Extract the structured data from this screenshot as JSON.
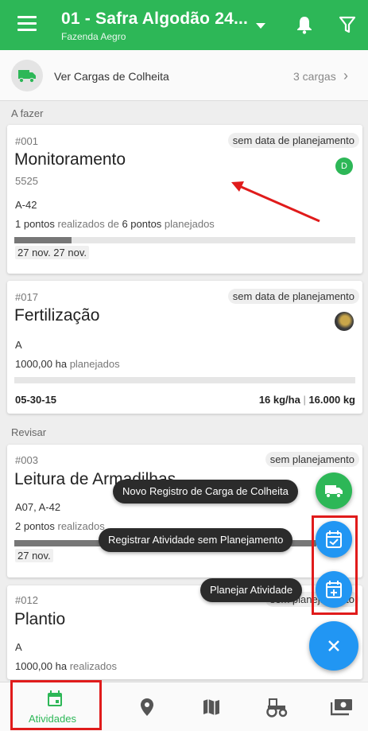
{
  "header": {
    "title": "01 - Safra Algodão 24...",
    "subtitle": "Fazenda Aegro",
    "menu_icon": "hamburger-menu-icon",
    "dropdown_icon": "caret-down-icon",
    "bell_icon": "bell-icon",
    "filter_icon": "filter-icon"
  },
  "cargas": {
    "label": "Ver Cargas de Colheita",
    "count": "3 cargas",
    "icon": "truck-icon"
  },
  "sections": {
    "todo": "A fazer",
    "review": "Revisar"
  },
  "cards": [
    {
      "number": "#001",
      "tag": "sem data de planejamento",
      "name": "Monitoramento",
      "sub": "5525",
      "area": "A-42",
      "progress_a": "1 pontos",
      "progress_b": " realizados de ",
      "progress_c": "6 pontos",
      "progress_d": " planejados",
      "progress_fraction": 0.167,
      "dates": "27 nov.  27 nov.",
      "avatar": "D"
    },
    {
      "number": "#017",
      "tag": "sem data de planejamento",
      "name": "Fertilização",
      "area": "A",
      "amount": "1000,00 ha",
      "amount_label": " planejados",
      "progress_fraction": 0,
      "date": "05-30-15",
      "dose": "16 kg/ha",
      "separator": " | ",
      "total": "16.000 kg"
    },
    {
      "number": "#003",
      "tag": "sem planejamento",
      "name": "Leitura de Armadilhas",
      "area": "A07, A-42",
      "amount": "2 pontos",
      "amount_label": " realizados",
      "dates": "27 nov."
    },
    {
      "number": "#012",
      "tag": "sem planejamento",
      "name": "Plantio",
      "area": "A",
      "amount": "1000,00 ha",
      "amount_label": " realizados"
    }
  ],
  "speed_dial": {
    "items": [
      {
        "label": "Novo Registro de Carga de Colheita",
        "icon": "truck-icon",
        "color": "#2db757"
      },
      {
        "label": "Registrar Atividade sem Planejamento",
        "icon": "calendar-check-icon",
        "color": "#2196f3"
      },
      {
        "label": "Planejar Atividade",
        "icon": "calendar-add-icon",
        "color": "#2196f3"
      }
    ],
    "close_icon": "close-icon",
    "close_color": "#2196f3"
  },
  "bottom_nav": {
    "items": [
      {
        "label": "Atividades",
        "icon": "calendar-icon",
        "active": true
      },
      {
        "icon": "location-pin-icon"
      },
      {
        "icon": "map-icon"
      },
      {
        "icon": "tractor-icon"
      },
      {
        "icon": "money-icon"
      }
    ]
  },
  "colors": {
    "brand_green": "#2db757",
    "fab_blue": "#2196f3",
    "annotation_red": "#e01b1b"
  }
}
